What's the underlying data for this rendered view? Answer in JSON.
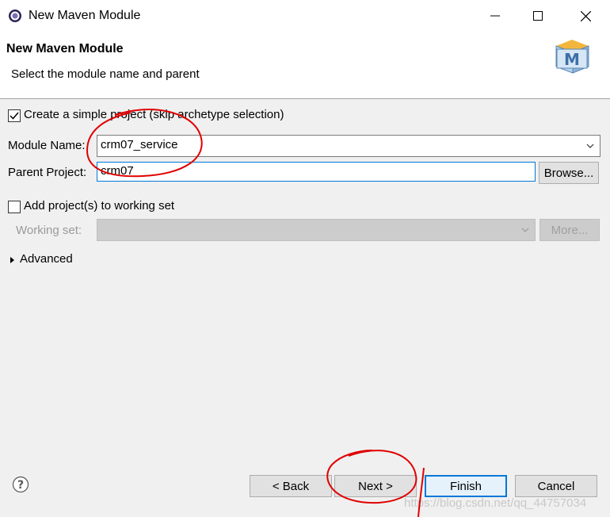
{
  "window": {
    "title": "New Maven Module"
  },
  "header": {
    "title": "New Maven Module",
    "description": "Select the module name and parent"
  },
  "form": {
    "simple_project_label": "Create a simple project (skip archetype selection)",
    "simple_project_checked": true,
    "module_name_label": "Module Name:",
    "module_name_value": "crm07_service",
    "parent_project_label": "Parent Project:",
    "parent_project_value": "crm07",
    "browse_label": "Browse...",
    "working_set_checkbox_label": "Add project(s) to working set",
    "working_set_checked": false,
    "working_set_label": "Working set:",
    "more_label": "More...",
    "advanced_label": "Advanced"
  },
  "footer": {
    "back_label": "< Back",
    "next_label": "Next >",
    "finish_label": "Finish",
    "cancel_label": "Cancel"
  },
  "watermark": "https://blog.csdn.net/qq_44757034",
  "colors": {
    "accent": "#0078d7",
    "annotation": "#e00000"
  }
}
